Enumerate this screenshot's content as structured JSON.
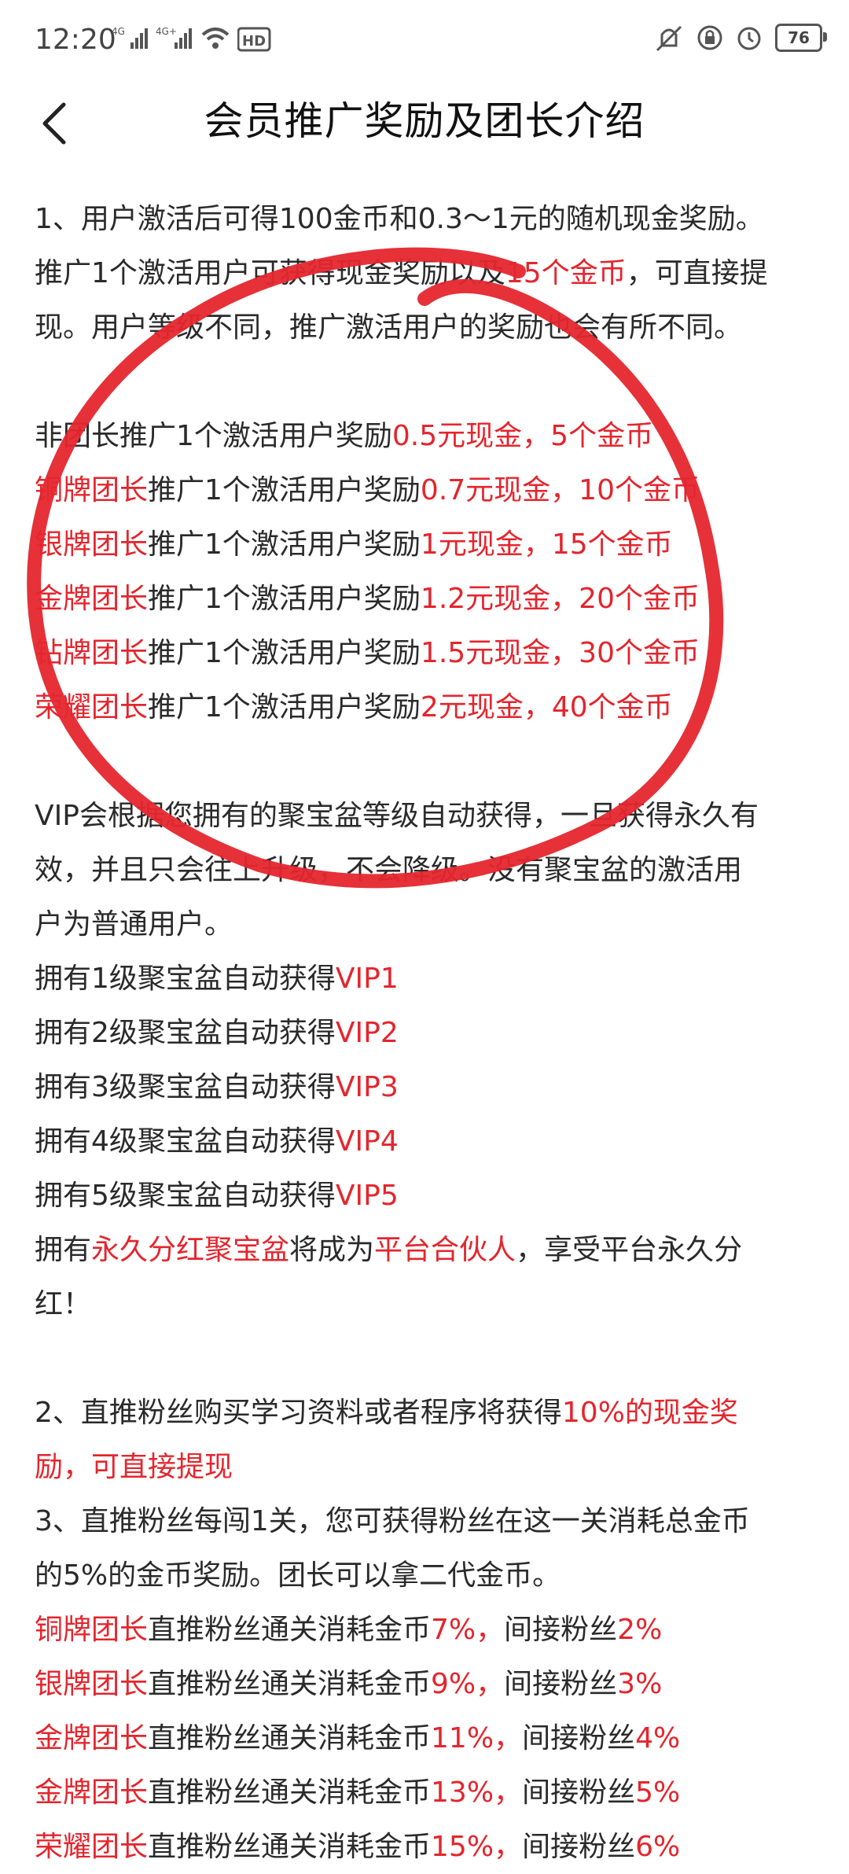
{
  "status_bar": {
    "time": "12:20",
    "network_1": "4G",
    "network_2": "4G+",
    "hd_label": "HD",
    "battery": "76"
  },
  "header": {
    "title": "会员推广奖励及团长介绍"
  },
  "section1": {
    "line1": "1、用户激活后可得100金币和0.3～1元的随机现金奖励。",
    "line2_pre": "推广1个激活用户可获得现金奖励以及",
    "line2_red": "15个金币",
    "line2_post": "，可直接提",
    "line3": "现。用户等级不同，推广激活用户的奖励也会有所不同。"
  },
  "leaders": [
    {
      "pre": "非团长推广1个激活用户奖励",
      "red": "0.5元现金，5个金币"
    },
    {
      "title": "铜牌团长",
      "mid": "推广1个激活用户奖励",
      "red": "0.7元现金，10个金币"
    },
    {
      "title": "银牌团长",
      "mid": "推广1个激活用户奖励",
      "red": "1元现金，15个金币"
    },
    {
      "title": "金牌团长",
      "mid": "推广1个激活用户奖励",
      "red": "1.2元现金，20个金币"
    },
    {
      "title": "钻牌团长",
      "mid": "推广1个激活用户奖励",
      "red": "1.5元现金，30个金币"
    },
    {
      "title": "荣耀团长",
      "mid": "推广1个激活用户奖励",
      "red": "2元现金，40个金币"
    }
  ],
  "vip": {
    "intro1": "VIP会根据您拥有的聚宝盆等级自动获得，一旦获得永久有",
    "intro2": "效，并且只会往上升级，不会降级。没有聚宝盆的激活用",
    "intro3": "户为普通用户。",
    "levels": [
      {
        "pre": "拥有1级聚宝盆自动获得",
        "red": "VIP1"
      },
      {
        "pre": "拥有2级聚宝盆自动获得",
        "red": "VIP2"
      },
      {
        "pre": "拥有3级聚宝盆自动获得",
        "red": "VIP3"
      },
      {
        "pre": "拥有4级聚宝盆自动获得",
        "red": "VIP4"
      },
      {
        "pre": "拥有5级聚宝盆自动获得",
        "red": "VIP5"
      }
    ],
    "partner_pre": "拥有",
    "partner_red1": "永久分红聚宝盆",
    "partner_mid": "将成为",
    "partner_red2": "平台合伙人",
    "partner_post": "，享受平台永久分",
    "partner_line2": "红！"
  },
  "section2": {
    "pre": "2、直推粉丝购买学习资料或者程序将获得",
    "red1": "10%的现金奖",
    "red2": "励，可直接提现"
  },
  "section3": {
    "line1": "3、直推粉丝每闯1关，您可获得粉丝在这一关消耗总金币",
    "line2": "的5%的金币奖励。团长可以拿二代金币。",
    "rows": [
      {
        "title": "铜牌团长",
        "mid": "直推粉丝通关消耗金币",
        "red1": "7%，",
        "mid2": "间接粉丝",
        "red2": "2%"
      },
      {
        "title": "银牌团长",
        "mid": "直推粉丝通关消耗金币",
        "red1": "9%，",
        "mid2": "间接粉丝",
        "red2": "3%"
      },
      {
        "title": "金牌团长",
        "mid": "直推粉丝通关消耗金币",
        "red1": "11%，",
        "mid2": "间接粉丝",
        "red2": "4%"
      },
      {
        "title": "金牌团长",
        "mid": "直推粉丝通关消耗金币",
        "red1": "13%，",
        "mid2": "间接粉丝",
        "red2": "5%"
      },
      {
        "title": "荣耀团长",
        "mid": "直推粉丝通关消耗金币",
        "red1": "15%，",
        "mid2": "间接粉丝",
        "red2": "6%"
      }
    ]
  },
  "colors": {
    "accent_red": "#e4252d",
    "scribble_red": "#e5262e"
  }
}
